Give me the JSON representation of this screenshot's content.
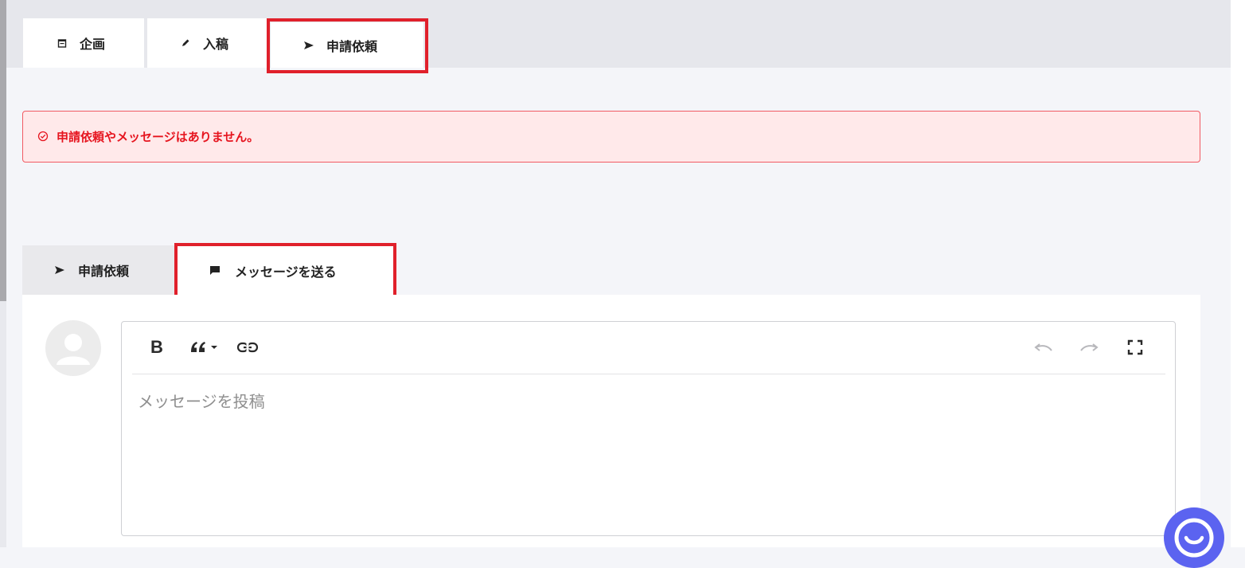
{
  "top_tabs": [
    {
      "label": "企画",
      "icon": "calendar-icon"
    },
    {
      "label": "入稿",
      "icon": "pencil-icon"
    },
    {
      "label": "申請依頼",
      "icon": "send-icon"
    }
  ],
  "alert": {
    "icon": "check-circle-icon",
    "text": "申請依頼やメッセージはありません。",
    "color": "#e6151f"
  },
  "bottom_tabs": [
    {
      "label": "申請依頼",
      "icon": "send-icon"
    },
    {
      "label": "メッセージを送る",
      "icon": "comment-icon"
    }
  ],
  "editor": {
    "toolbar": {
      "bold_label": "B",
      "icons": [
        "quote-icon",
        "link-icon",
        "undo-icon",
        "redo-icon",
        "fullscreen-icon"
      ]
    },
    "placeholder": "メッセージを投稿"
  },
  "colors": {
    "highlight": "#e0202b",
    "chat_button": "#5b63f0"
  }
}
